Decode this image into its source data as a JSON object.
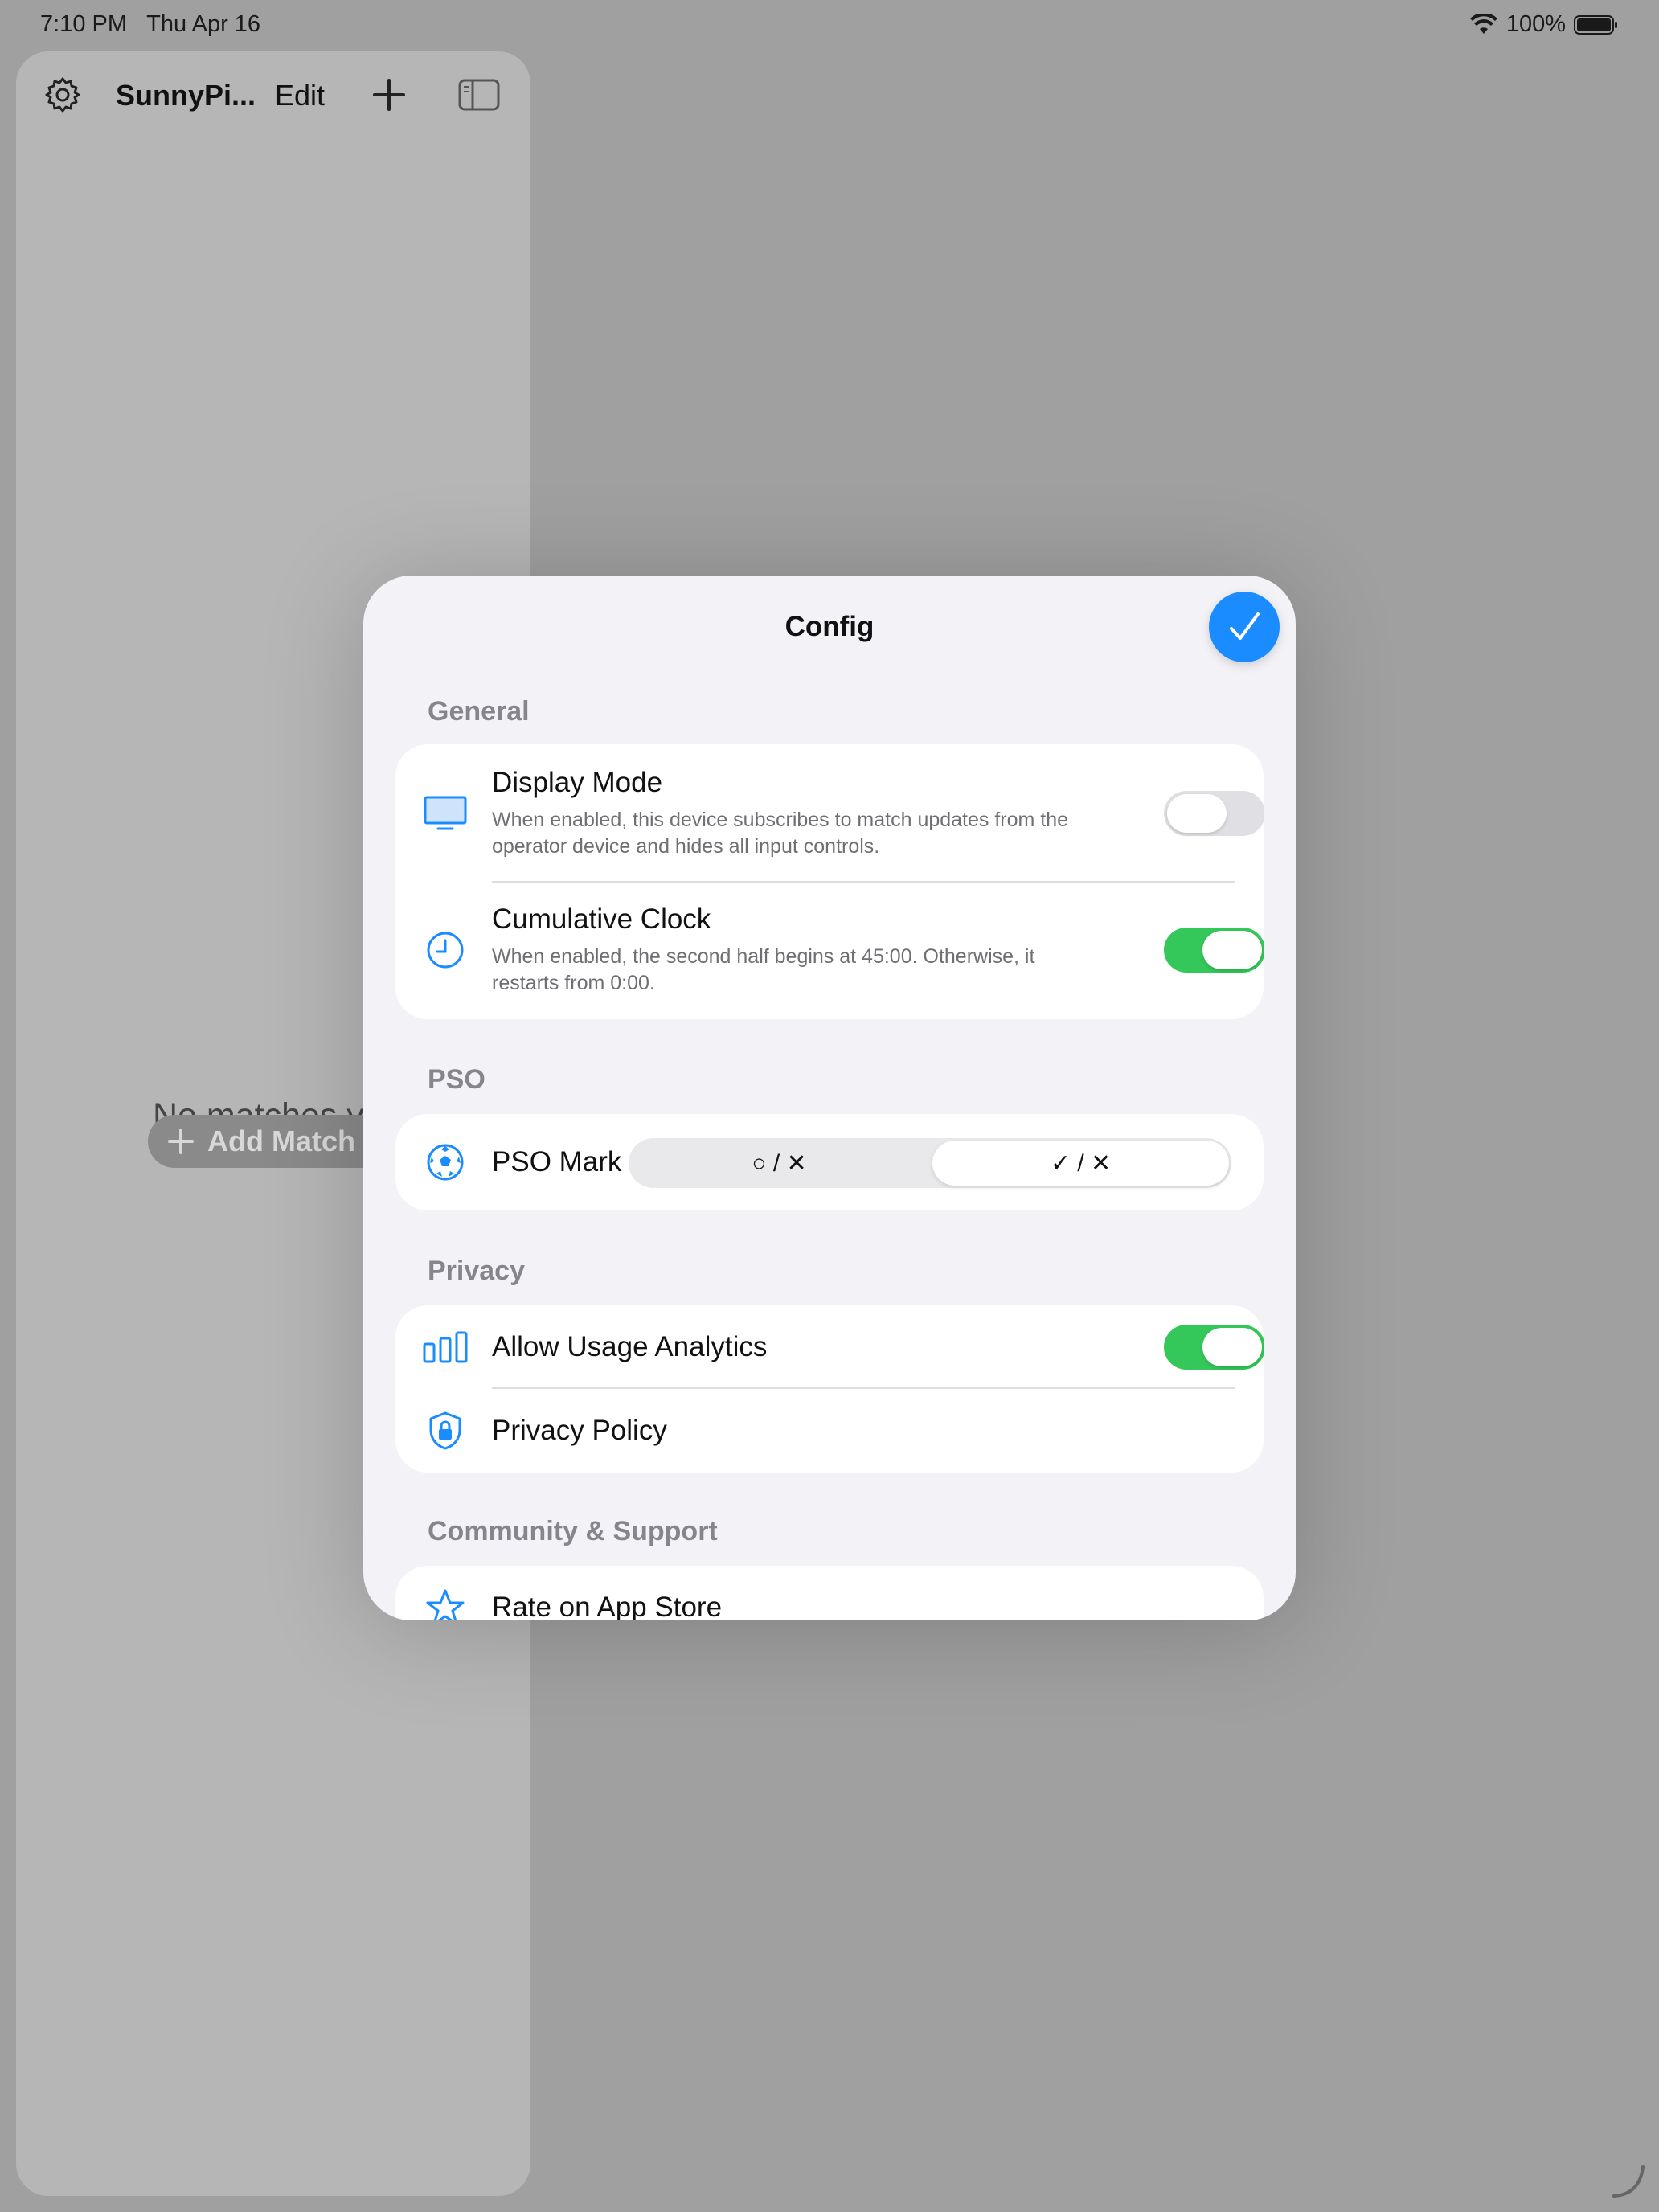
{
  "status_bar": {
    "time": "7:10 PM",
    "date": "Thu Apr 16",
    "battery": "100%"
  },
  "sidebar": {
    "title": "SunnyPi...",
    "edit_label": "Edit",
    "empty_text": "No matches y",
    "add_match_label": "Add Match"
  },
  "modal": {
    "title": "Config",
    "sections": {
      "general": {
        "header": "General",
        "display_mode": {
          "title": "Display Mode",
          "desc": "When enabled, this device subscribes to match updates from the operator device and hides all input controls.",
          "enabled": false
        },
        "cumulative_clock": {
          "title": "Cumulative Clock",
          "desc": "When enabled, the second half begins at 45:00. Otherwise, it restarts from 0:00.",
          "enabled": true
        }
      },
      "pso": {
        "header": "PSO",
        "pso_mark": {
          "title": "PSO Mark",
          "options": [
            "○ / ✕",
            "✓ / ✕"
          ],
          "selected_index": 1
        }
      },
      "privacy": {
        "header": "Privacy",
        "analytics": {
          "title": "Allow Usage Analytics",
          "enabled": true
        },
        "privacy_policy": {
          "title": "Privacy Policy"
        }
      },
      "community": {
        "header": "Community & Support",
        "rate": {
          "title": "Rate on App Store"
        }
      }
    }
  },
  "colors": {
    "accent": "#1a8cff",
    "toggle_on": "#34c759",
    "toggle_off": "#e0e0e4",
    "background_dim": "#a0a0a0",
    "sheet_bg": "#f2f2f7"
  },
  "icons": {
    "display_mode": "display-icon",
    "cumulative_clock": "clock-icon",
    "pso_mark": "soccer-ball-icon",
    "analytics": "chart-bars-icon",
    "privacy_policy": "shield-lock-icon",
    "rate": "star-icon"
  }
}
